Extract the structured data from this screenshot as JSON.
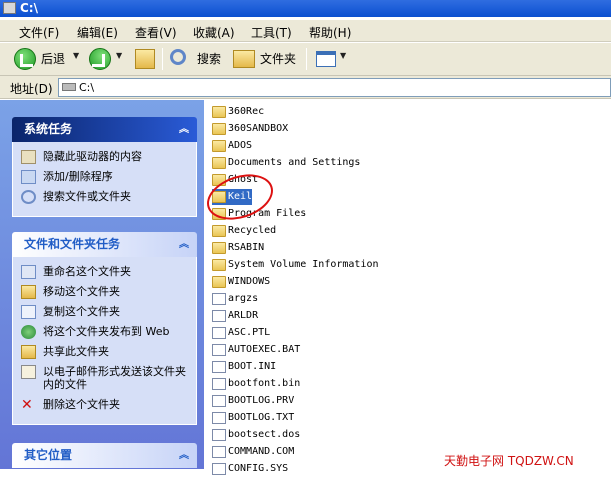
{
  "window": {
    "title": "C:\\"
  },
  "menu": [
    "文件(F)",
    "编辑(E)",
    "查看(V)",
    "收藏(A)",
    "工具(T)",
    "帮助(H)"
  ],
  "toolbar": {
    "back": "后退",
    "search": "搜索",
    "folders": "文件夹"
  },
  "address": {
    "label": "地址(D)",
    "value": "C:\\"
  },
  "system_tasks": {
    "title": "系统任务",
    "items": [
      "隐藏此驱动器的内容",
      "添加/删除程序",
      "搜索文件或文件夹"
    ]
  },
  "file_tasks": {
    "title": "文件和文件夹任务",
    "items": [
      "重命名这个文件夹",
      "移动这个文件夹",
      "复制这个文件夹",
      "将这个文件夹发布到 Web",
      "共享此文件夹",
      "以电子邮件形式发送该文件夹内的文件",
      "删除这个文件夹"
    ]
  },
  "other_places": {
    "title": "其它位置"
  },
  "files": [
    {
      "name": "360Rec",
      "type": "folder"
    },
    {
      "name": "360SANDBOX",
      "type": "folder"
    },
    {
      "name": "ADOS",
      "type": "folder"
    },
    {
      "name": "Documents and Settings",
      "type": "folder"
    },
    {
      "name": "Ghost",
      "type": "folder"
    },
    {
      "name": "Keil",
      "type": "folder",
      "selected": true
    },
    {
      "name": "Program Files",
      "type": "folder"
    },
    {
      "name": "Recycled",
      "type": "folder"
    },
    {
      "name": "RSABIN",
      "type": "folder"
    },
    {
      "name": "System Volume Information",
      "type": "folder"
    },
    {
      "name": "WINDOWS",
      "type": "folder"
    },
    {
      "name": "argzs",
      "type": "file"
    },
    {
      "name": "ARLDR",
      "type": "file"
    },
    {
      "name": "ASC.PTL",
      "type": "file"
    },
    {
      "name": "AUTOEXEC.BAT",
      "type": "file"
    },
    {
      "name": "BOOT.INI",
      "type": "file"
    },
    {
      "name": "bootfont.bin",
      "type": "file"
    },
    {
      "name": "BOOTLOG.PRV",
      "type": "file"
    },
    {
      "name": "BOOTLOG.TXT",
      "type": "file"
    },
    {
      "name": "bootsect.dos",
      "type": "file"
    },
    {
      "name": "COMMAND.COM",
      "type": "file"
    },
    {
      "name": "CONFIG.SYS",
      "type": "file"
    }
  ],
  "watermark": "天勤电子网 TQDZW.CN"
}
